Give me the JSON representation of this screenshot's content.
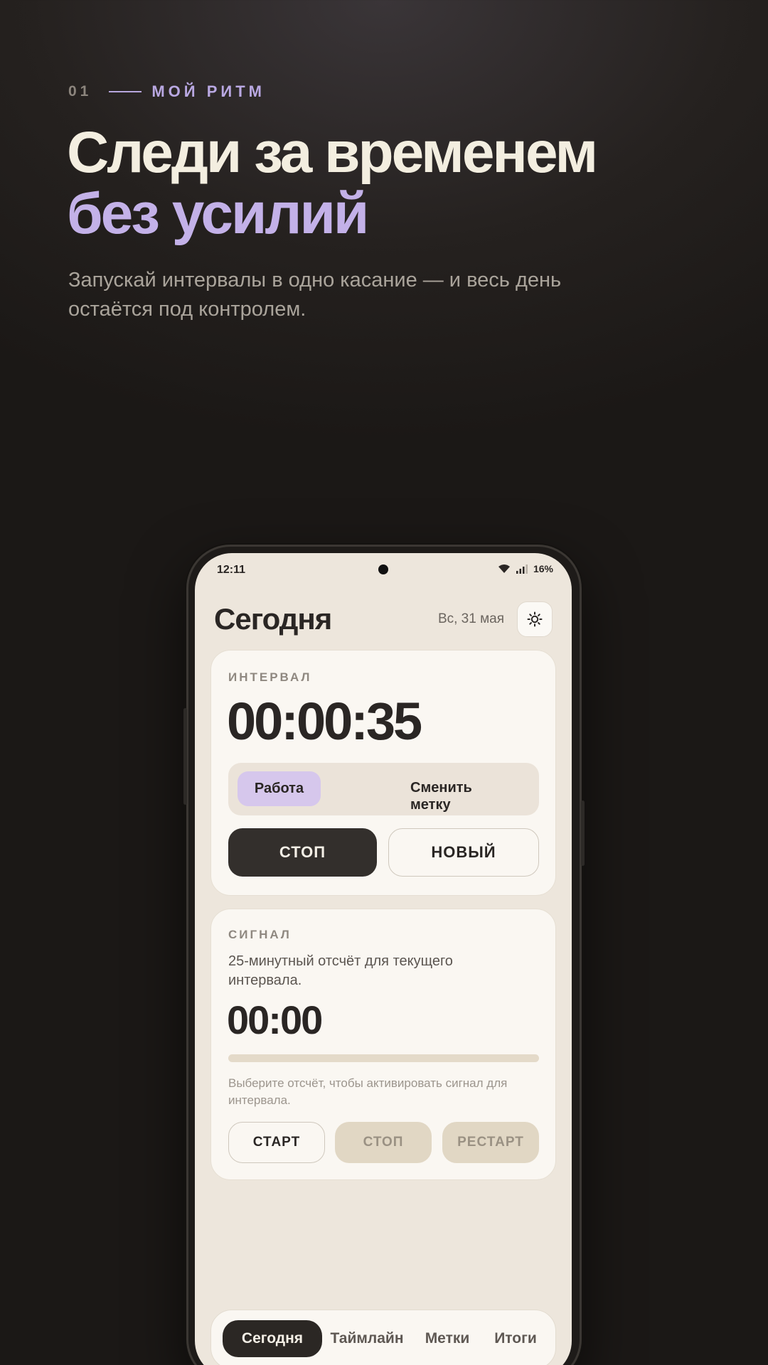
{
  "promo": {
    "index": "01",
    "tag": "МОЙ РИТМ",
    "headline_line1": "Следи за временем",
    "headline_line2": "без усилий",
    "subtitle": "Запускай интервалы в одно касание — и весь день остаётся под контролем."
  },
  "status_bar": {
    "time": "12:11",
    "battery": "16%",
    "icons": [
      "wifi-icon",
      "signal-icon"
    ]
  },
  "header": {
    "title": "Сегодня",
    "date": "Вс, 31 мая",
    "theme_icon": "sun-icon"
  },
  "interval_card": {
    "label": "ИНТЕРВАЛ",
    "elapsed": "00:00:35",
    "active_tag": "Работа",
    "change_tag": "Сменить метку",
    "stop_label": "СТОП",
    "new_label": "НОВЫЙ"
  },
  "signal_card": {
    "label": "СИГНАЛ",
    "description": "25-минутный отсчёт для текущего интервала.",
    "countdown": "00:00",
    "progress": 0,
    "hint": "Выберите отсчёт, чтобы активировать сигнал для интервала.",
    "start_label": "СТАРТ",
    "stop_label": "СТОП",
    "restart_label": "РЕСТАРТ"
  },
  "bottom_nav": {
    "items": [
      "Сегодня",
      "Таймлайн",
      "Метки",
      "Итоги"
    ],
    "active": "Сегодня"
  }
}
